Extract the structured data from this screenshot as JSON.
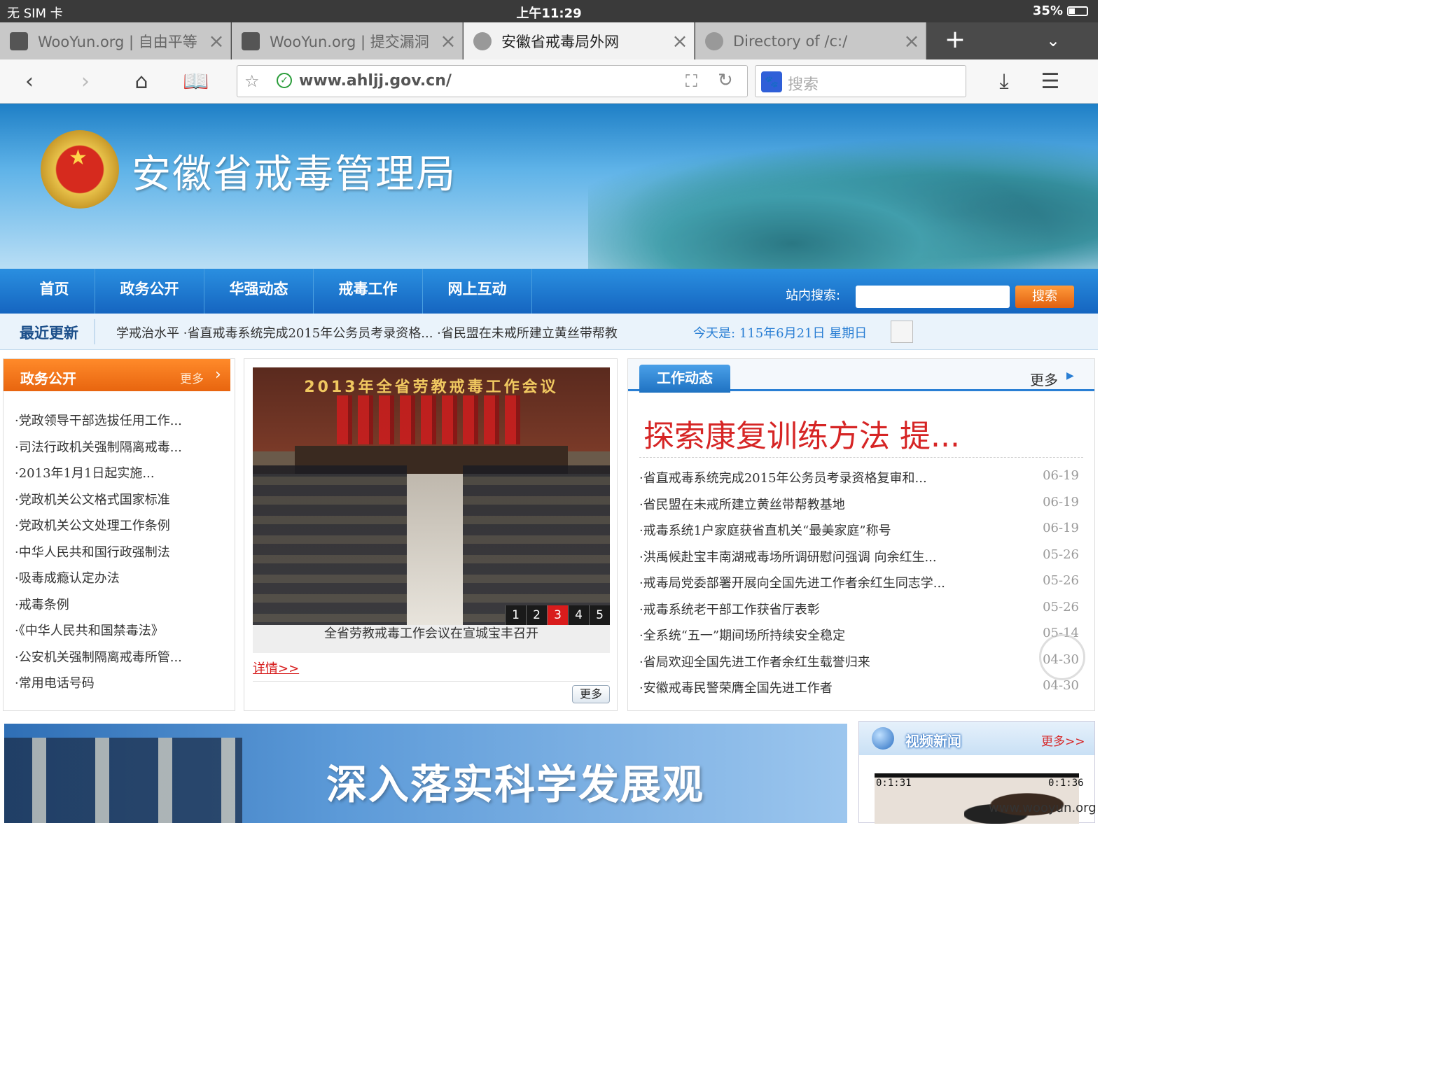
{
  "status_bar": {
    "carrier": "无 SIM 卡",
    "time": "上午11:29",
    "battery": "35%"
  },
  "tabs": [
    {
      "title": "WooYun.org | 自由平等",
      "active": false
    },
    {
      "title": "WooYun.org | 提交漏洞",
      "active": false
    },
    {
      "title": "安徽省戒毒局外网",
      "active": true
    },
    {
      "title": "Directory of /c:/",
      "active": false
    }
  ],
  "toolbar": {
    "url": "www.ahljj.gov.cn/",
    "search_placeholder": "搜索"
  },
  "header": {
    "site_title": "安徽省戒毒管理局"
  },
  "nav": {
    "items": [
      "首页",
      "政务公开",
      "华强动态",
      "戒毒工作",
      "网上互动"
    ],
    "search_label": "站内搜索:",
    "search_button": "搜索"
  },
  "recent": {
    "label": "最近更新",
    "ticker": "学戒治水平  ·省直戒毒系统完成2015年公务员考录资格...  ·省民盟在未戒所建立黄丝带帮教",
    "date": "今天是: 115年6月21日 星期日"
  },
  "left_panel": {
    "title": "政务公开",
    "more": "更多",
    "items": [
      "·党政领导干部选拔任用工作...",
      "·司法行政机关强制隔离戒毒...",
      "·2013年1月1日起实施...",
      "·党政机关公文格式国家标准",
      "·党政机关公文处理工作条例",
      "·中华人民共和国行政强制法",
      "·吸毒成瘾认定办法",
      "·戒毒条例",
      "·《中华人民共和国禁毒法》",
      "·公安机关强制隔离戒毒所管...",
      "·常用电话号码"
    ]
  },
  "mid_panel": {
    "photo_banner": "2013年全省劳教戒毒工作会议",
    "pager": [
      "1",
      "2",
      "3",
      "4",
      "5"
    ],
    "active_page": "3",
    "caption": "全省劳教戒毒工作会议在宣城宝丰召开",
    "detail_link": "详情>>",
    "more": "更多"
  },
  "right_panel": {
    "tab": "工作动态",
    "more": "更多",
    "headline": "探索康复训练方法 提...",
    "items": [
      {
        "title": "·省直戒毒系统完成2015年公务员考录资格复审和...",
        "date": "06-19"
      },
      {
        "title": "·省民盟在未戒所建立黄丝带帮教基地",
        "date": "06-19"
      },
      {
        "title": "·戒毒系统1户家庭获省直机关“最美家庭”称号",
        "date": "06-19"
      },
      {
        "title": "·洪禹候赴宝丰南湖戒毒场所调研慰问强调 向余红生...",
        "date": "05-26"
      },
      {
        "title": "·戒毒局党委部署开展向全国先进工作者余红生同志学...",
        "date": "05-26"
      },
      {
        "title": "·戒毒系统老干部工作获省厅表彰",
        "date": "05-26"
      },
      {
        "title": "·全系统“五一”期间场所持续安全稳定",
        "date": "05-14"
      },
      {
        "title": "·省局欢迎全国先进工作者余红生载誉归来",
        "date": "04-30"
      },
      {
        "title": "·安徽戒毒民警荣膺全国先进工作者",
        "date": "04-30"
      }
    ]
  },
  "slogan": {
    "text": "深入落实科学发展观"
  },
  "video": {
    "title": "视频新闻",
    "more": "更多>>",
    "time_left": "0:1:31",
    "time_right": "0:1:36"
  },
  "watermark": "www.wooyun.org"
}
